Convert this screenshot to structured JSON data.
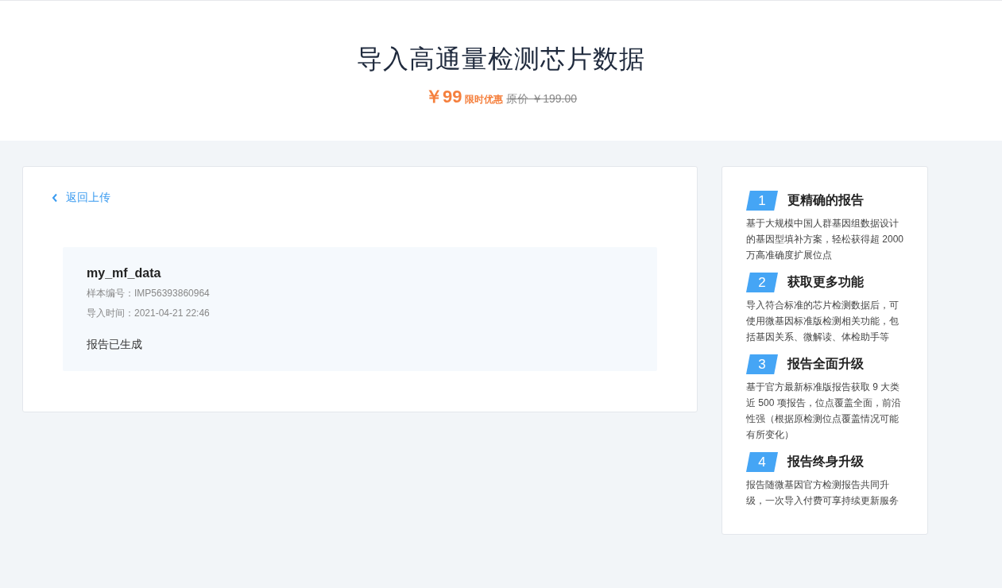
{
  "header": {
    "title": "导入高通量检测芯片数据",
    "price": "￥99",
    "promo": "限时优惠",
    "original_price": "原价 ￥199.00"
  },
  "back_link": "返回上传",
  "sample": {
    "name": "my_mf_data",
    "id_label": "样本编号：IMP56393860964",
    "time_label": "导入时间：2021-04-21 22:46",
    "status": "报告已生成"
  },
  "benefits": [
    {
      "number": "1",
      "title": "更精确的报告",
      "description": "基于大规模中国人群基因组数据设计的基因型填补方案，轻松获得超 2000 万高准确度扩展位点"
    },
    {
      "number": "2",
      "title": "获取更多功能",
      "description": "导入符合标准的芯片检测数据后，可使用微基因标准版检测相关功能，包括基因关系、微解读、体检助手等"
    },
    {
      "number": "3",
      "title": "报告全面升级",
      "description": "基于官方最新标准版报告获取 9 大类近 500 项报告，位点覆盖全面，前沿性强（根据原检测位点覆盖情况可能有所变化）"
    },
    {
      "number": "4",
      "title": "报告终身升级",
      "description": "报告随微基因官方检测报告共同升级，一次导入付费可享持续更新服务"
    }
  ]
}
